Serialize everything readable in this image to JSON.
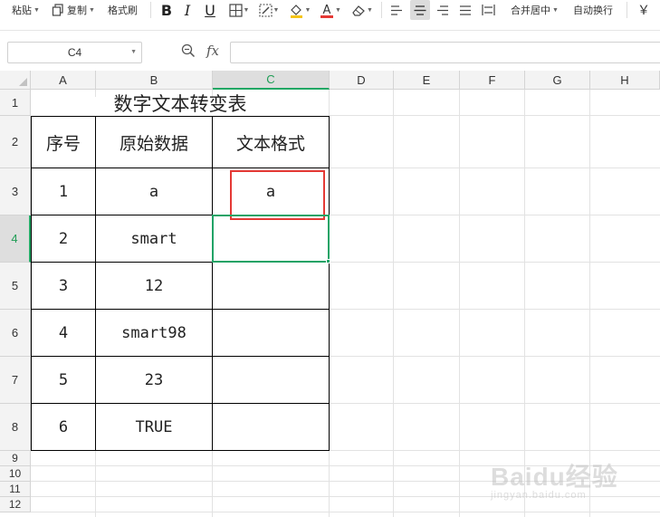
{
  "toolbar": {
    "paste_label": "粘贴",
    "copy_label": "复制",
    "format_painter_label": "格式刷",
    "merge_center_label": "合并居中",
    "wrap_text_label": "自动换行",
    "currency_symbol": "￥",
    "font_color": "#e53935",
    "fill_color": "#f5c518"
  },
  "formula_bar": {
    "name_box": "C4",
    "fx_label": "fx",
    "formula_value": ""
  },
  "columns": [
    "A",
    "B",
    "C",
    "D",
    "E",
    "F",
    "G",
    "H"
  ],
  "rows": [
    "1",
    "2",
    "3",
    "4",
    "5",
    "6",
    "7",
    "8",
    "9",
    "10",
    "11",
    "12"
  ],
  "selected_cell": {
    "column": "C",
    "row": "4"
  },
  "sheet": {
    "title": "数字文本转变表",
    "headers": [
      "序号",
      "原始数据",
      "文本格式"
    ],
    "data": [
      [
        "1",
        "a",
        "a"
      ],
      [
        "2",
        "smart",
        ""
      ],
      [
        "3",
        "12",
        ""
      ],
      [
        "4",
        "smart98",
        ""
      ],
      [
        "5",
        "23",
        ""
      ],
      [
        "6",
        "TRUE",
        ""
      ]
    ]
  },
  "watermark": {
    "brand": "Baidu经验",
    "sub": "jingyan.baidu.com"
  },
  "colors": {
    "selection_green": "#21a366",
    "highlight_red": "#e53935"
  }
}
